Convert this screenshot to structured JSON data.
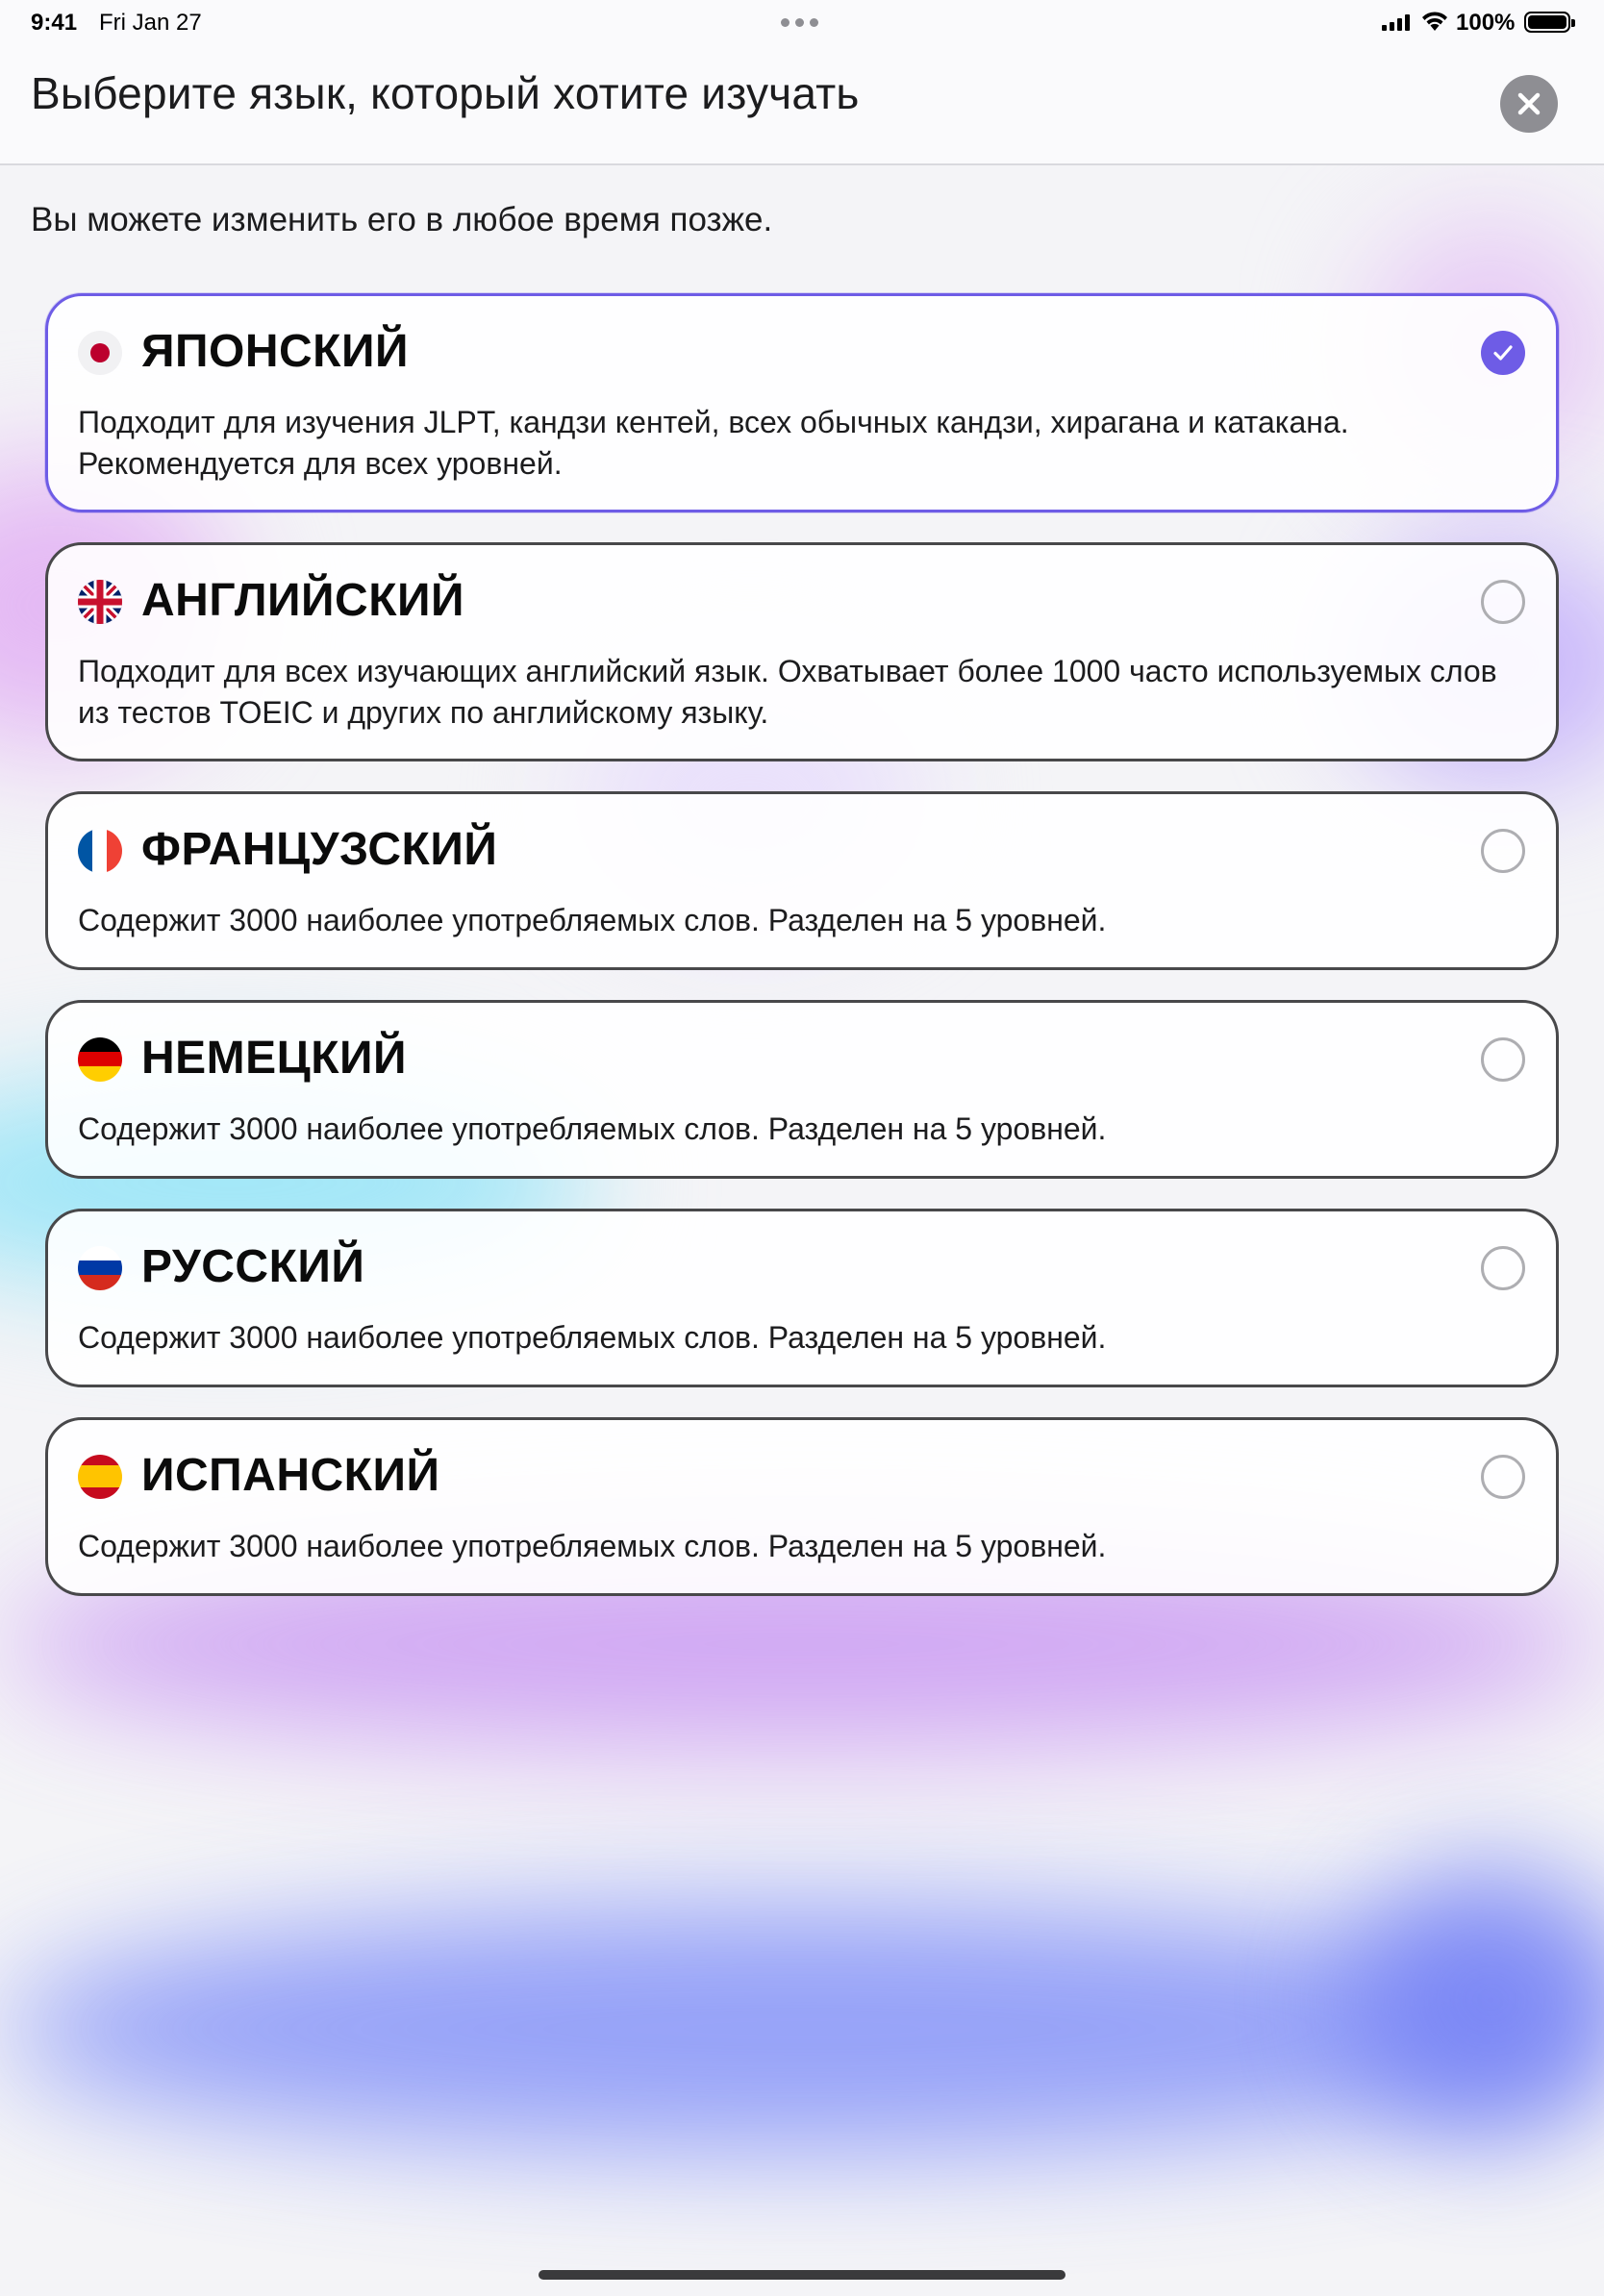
{
  "status_bar": {
    "time": "9:41",
    "date": "Fri Jan 27",
    "battery": "100%"
  },
  "header": {
    "title": "Выберите язык, который хотите изучать",
    "close_icon": "close-icon"
  },
  "subtitle": "Вы можете изменить его в любое время позже.",
  "accent_color": "#6e5ce6",
  "languages": [
    {
      "name": "ЯПОНСКИЙ",
      "flag_icon": "japan-flag-icon",
      "description": "Подходит для изучения JLPT, кандзи кентей, всех обычных кандзи, хирагана и катакана. Рекомендуется для всех уровней.",
      "selected": true
    },
    {
      "name": "АНГЛИЙСКИЙ",
      "flag_icon": "uk-flag-icon",
      "description": "Подходит для всех изучающих английский язык. Охватывает более 1000 часто используемых слов из тестов TOEIC и других по английскому языку.",
      "selected": false
    },
    {
      "name": "ФРАНЦУЗСКИЙ",
      "flag_icon": "france-flag-icon",
      "description": "Содержит 3000 наиболее употребляемых слов. Разделен на 5 уровней.",
      "selected": false
    },
    {
      "name": "НЕМЕЦКИЙ",
      "flag_icon": "germany-flag-icon",
      "description": "Содержит 3000 наиболее употребляемых слов. Разделен на 5 уровней.",
      "selected": false
    },
    {
      "name": "РУССКИЙ",
      "flag_icon": "russia-flag-icon",
      "description": "Содержит 3000 наиболее употребляемых слов. Разделен на 5 уровней.",
      "selected": false
    },
    {
      "name": "ИСПАНСКИЙ",
      "flag_icon": "spain-flag-icon",
      "description": "Содержит 3000 наиболее употребляемых слов. Разделен на 5 уровней.",
      "selected": false
    }
  ]
}
